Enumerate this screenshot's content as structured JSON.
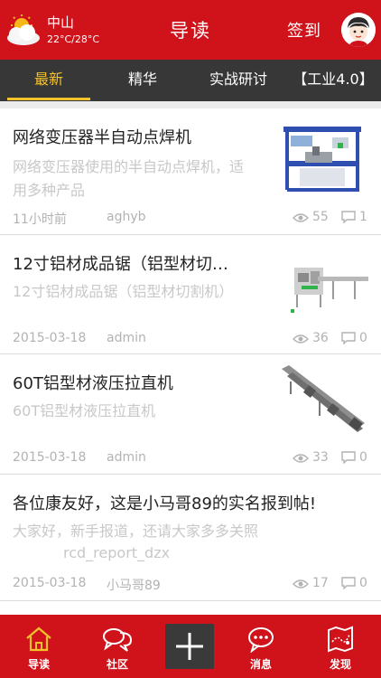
{
  "header": {
    "city": "中山",
    "temperature": "22°C/28°C",
    "title": "导读",
    "checkin_label": "签到"
  },
  "tabs": [
    {
      "label": "最新",
      "active": true
    },
    {
      "label": "精华",
      "active": false
    },
    {
      "label": "实战研讨",
      "active": false
    },
    {
      "label": "【工业4.0】",
      "active": false
    }
  ],
  "feed": [
    {
      "title": "网络变压器半自动点焊机",
      "desc": "网络变压器使用的半自动点焊机，适用多种产品",
      "time": "11小时前",
      "author": "aghyb",
      "views": "55",
      "comments": "1"
    },
    {
      "title": "12寸铝材成品锯（铝型材切…",
      "desc": "12寸铝材成品锯（铝型材切割机）",
      "time": "2015-03-18",
      "author": "admin",
      "views": "36",
      "comments": "0"
    },
    {
      "title": "60T铝型材液压拉直机",
      "desc": "60T铝型材液压拉直机",
      "time": "2015-03-18",
      "author": "admin",
      "views": "33",
      "comments": "0"
    },
    {
      "title": "各位康友好，这是小马哥89的实名报到帖!",
      "desc": "大家好，新手报道，还请大家多多关照",
      "desc2": "rcd_report_dzx",
      "time": "2015-03-18",
      "author": "小马哥89",
      "views": "17",
      "comments": "0"
    }
  ],
  "bottom_nav": [
    {
      "label": "导读",
      "icon": "home-icon"
    },
    {
      "label": "社区",
      "icon": "chat-bubbles-icon"
    },
    {
      "label": "",
      "icon": "plus-icon"
    },
    {
      "label": "消息",
      "icon": "message-icon"
    },
    {
      "label": "发现",
      "icon": "map-icon"
    }
  ],
  "colors": {
    "brand_red": "#d0121a",
    "tab_bar": "#373737",
    "tab_active": "#f4c22b"
  }
}
